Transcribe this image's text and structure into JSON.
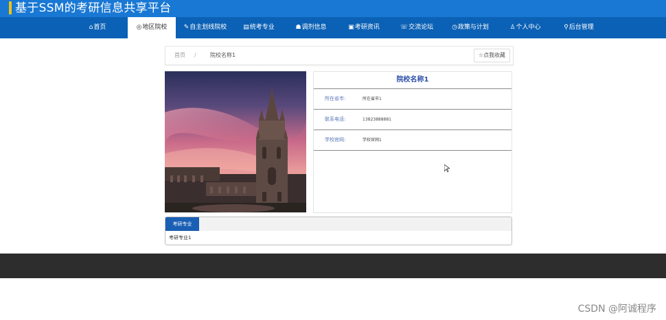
{
  "header": {
    "title": "基于SSM的考研信息共享平台",
    "accent": "#1978d4"
  },
  "nav": [
    {
      "icon": "⌂",
      "label": "首页"
    },
    {
      "icon": "◎",
      "label": "地区院校"
    },
    {
      "icon": "✎",
      "label": "自主划线院校"
    },
    {
      "icon": "▤",
      "label": "统考专业"
    },
    {
      "icon": "☗",
      "label": "调剂信息"
    },
    {
      "icon": "▣",
      "label": "考研资讯"
    },
    {
      "icon": "☏",
      "label": "交流论坛"
    },
    {
      "icon": "◷",
      "label": "政策与计划"
    },
    {
      "icon": "♙",
      "label": "个人中心"
    },
    {
      "icon": "⚲",
      "label": "后台管理"
    }
  ],
  "breadcrumb": {
    "home": "首页",
    "separator": "/",
    "current": "院校名称1"
  },
  "favorite_button": {
    "icon": "☆",
    "label": "点我收藏"
  },
  "school": {
    "name": "院校名称1",
    "fields": [
      {
        "label": "所在省市:",
        "value": "所在省市1"
      },
      {
        "label": "联系电话:",
        "value": "13823888881"
      },
      {
        "label": "学校官网:",
        "value": "学校官网1"
      }
    ]
  },
  "tabs": {
    "active_label": "考研专业",
    "content": "考研专业1"
  },
  "watermark": "CSDN @阿诚程序"
}
